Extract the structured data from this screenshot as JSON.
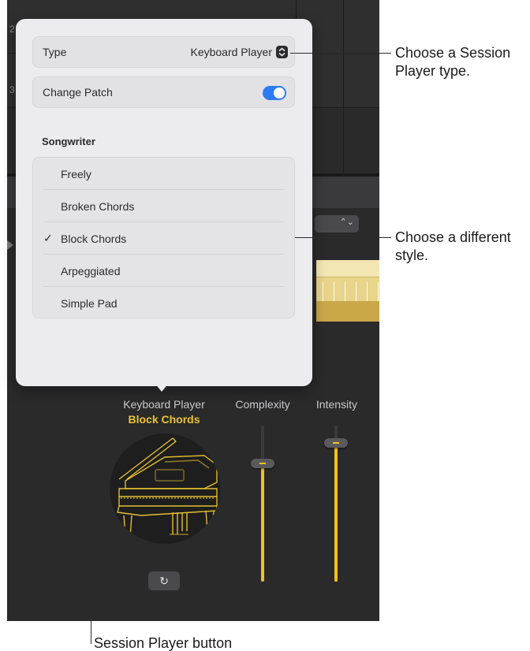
{
  "background": {
    "track_numbers": [
      "2",
      "3"
    ]
  },
  "popover": {
    "type_row": {
      "label": "Type",
      "value": "Keyboard Player",
      "stepper_icon": "up-down-chevron-icon"
    },
    "patch_row": {
      "label": "Change Patch",
      "toggle_on": true
    },
    "section_heading": "Songwriter",
    "styles": [
      {
        "label": "Freely",
        "checked": false
      },
      {
        "label": "Broken Chords",
        "checked": false
      },
      {
        "label": "Block Chords",
        "checked": true
      },
      {
        "label": "Arpeggiated",
        "checked": false
      },
      {
        "label": "Simple Pad",
        "checked": false
      }
    ],
    "check_mark": "✓"
  },
  "player": {
    "name": "Keyboard Player",
    "style": "Block Chords",
    "icon": "grand-piano-icon",
    "refresh_icon": "refresh-icon",
    "refresh_glyph": "↻"
  },
  "sliders": {
    "complexity": {
      "label": "Complexity",
      "value": 0.76
    },
    "intensity": {
      "label": "Intensity",
      "value": 0.89
    }
  },
  "callouts": {
    "type_line1": "Choose a Session",
    "type_line2": "Player type.",
    "style_line1": "Choose a different",
    "style_line2": "style.",
    "button_label": "Session Player button"
  },
  "colors": {
    "accent": "#f1c21b",
    "toggle": "#2f7bf5",
    "app_background": "#2a2a2b",
    "popover": "#ececee"
  }
}
